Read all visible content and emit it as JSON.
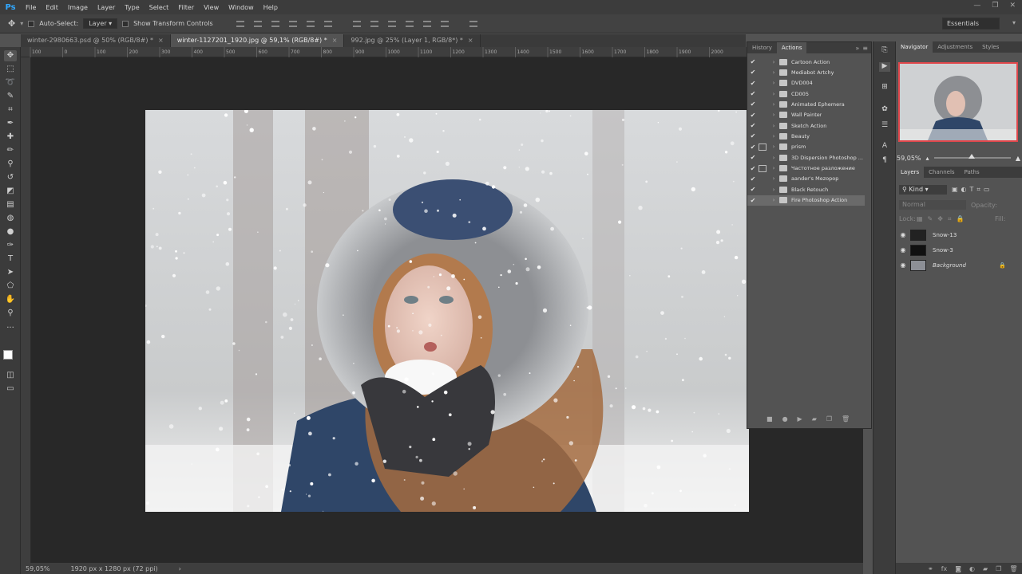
{
  "app": {
    "logo": "Ps"
  },
  "menu": [
    "File",
    "Edit",
    "Image",
    "Layer",
    "Type",
    "Select",
    "Filter",
    "View",
    "Window",
    "Help"
  ],
  "options": {
    "auto_select_label": "Auto-Select:",
    "auto_select_target": "Layer",
    "transform_label": "Show Transform Controls",
    "workspace": "Essentials"
  },
  "tabs": [
    {
      "label": "winter-2980663.psd @ 50% (RGB/8#) *",
      "active": false
    },
    {
      "label": "winter-1127201_1920.jpg @ 59,1% (RGB/8#) *",
      "active": true
    },
    {
      "label": "992.jpg @ 25% (Layer 1, RGB/8*) *",
      "active": false
    }
  ],
  "rulers": {
    "h": [
      "100",
      "0",
      "100",
      "200",
      "300",
      "400",
      "500",
      "600",
      "700",
      "800",
      "900",
      "1000",
      "1100",
      "1200",
      "1300",
      "1400",
      "1500",
      "1600",
      "1700",
      "1800",
      "1900",
      "2000"
    ]
  },
  "status": {
    "zoom": "59,05%",
    "docsize": "1920 px x 1280 px (72 ppi)"
  },
  "actions_panel": {
    "tabs": [
      "History",
      "Actions"
    ],
    "items": [
      {
        "name": "Cartoon Action",
        "dialog": false
      },
      {
        "name": "Mediabot Artchy",
        "dialog": false
      },
      {
        "name": "DVD004",
        "dialog": false
      },
      {
        "name": "CD005",
        "dialog": false
      },
      {
        "name": "Animated Ephemera",
        "dialog": false
      },
      {
        "name": "Wall Painter",
        "dialog": false
      },
      {
        "name": "Sketch Action",
        "dialog": false
      },
      {
        "name": "Beauty",
        "dialog": false
      },
      {
        "name": "prism",
        "dialog": true
      },
      {
        "name": "3D Dispersion Photoshop ...",
        "dialog": false
      },
      {
        "name": "Частотное разложение",
        "dialog": true
      },
      {
        "name": "aander's Мezopop",
        "dialog": false
      },
      {
        "name": "Black Retouch",
        "dialog": false
      },
      {
        "name": "Fire Photoshop Action",
        "dialog": false,
        "highlighted": true
      }
    ]
  },
  "right_panels": {
    "nav_tabs": [
      "Navigator",
      "Adjustments",
      "Styles"
    ],
    "nav_zoom": "59,05%",
    "layer_tabs": [
      "Layers",
      "Channels",
      "Paths"
    ],
    "filter_kind": "Kind",
    "blend_mode": "Normal",
    "opacity_label": "Opacity:",
    "lock_label": "Lock:",
    "fill_label": "Fill:",
    "layers": [
      {
        "name": "Snow-13",
        "italic": false
      },
      {
        "name": "Snow-3",
        "italic": false
      },
      {
        "name": "Background",
        "italic": true,
        "locked": true
      }
    ]
  },
  "colors": {
    "accent_red": "#e0474c",
    "ps_blue": "#31a8ff"
  }
}
